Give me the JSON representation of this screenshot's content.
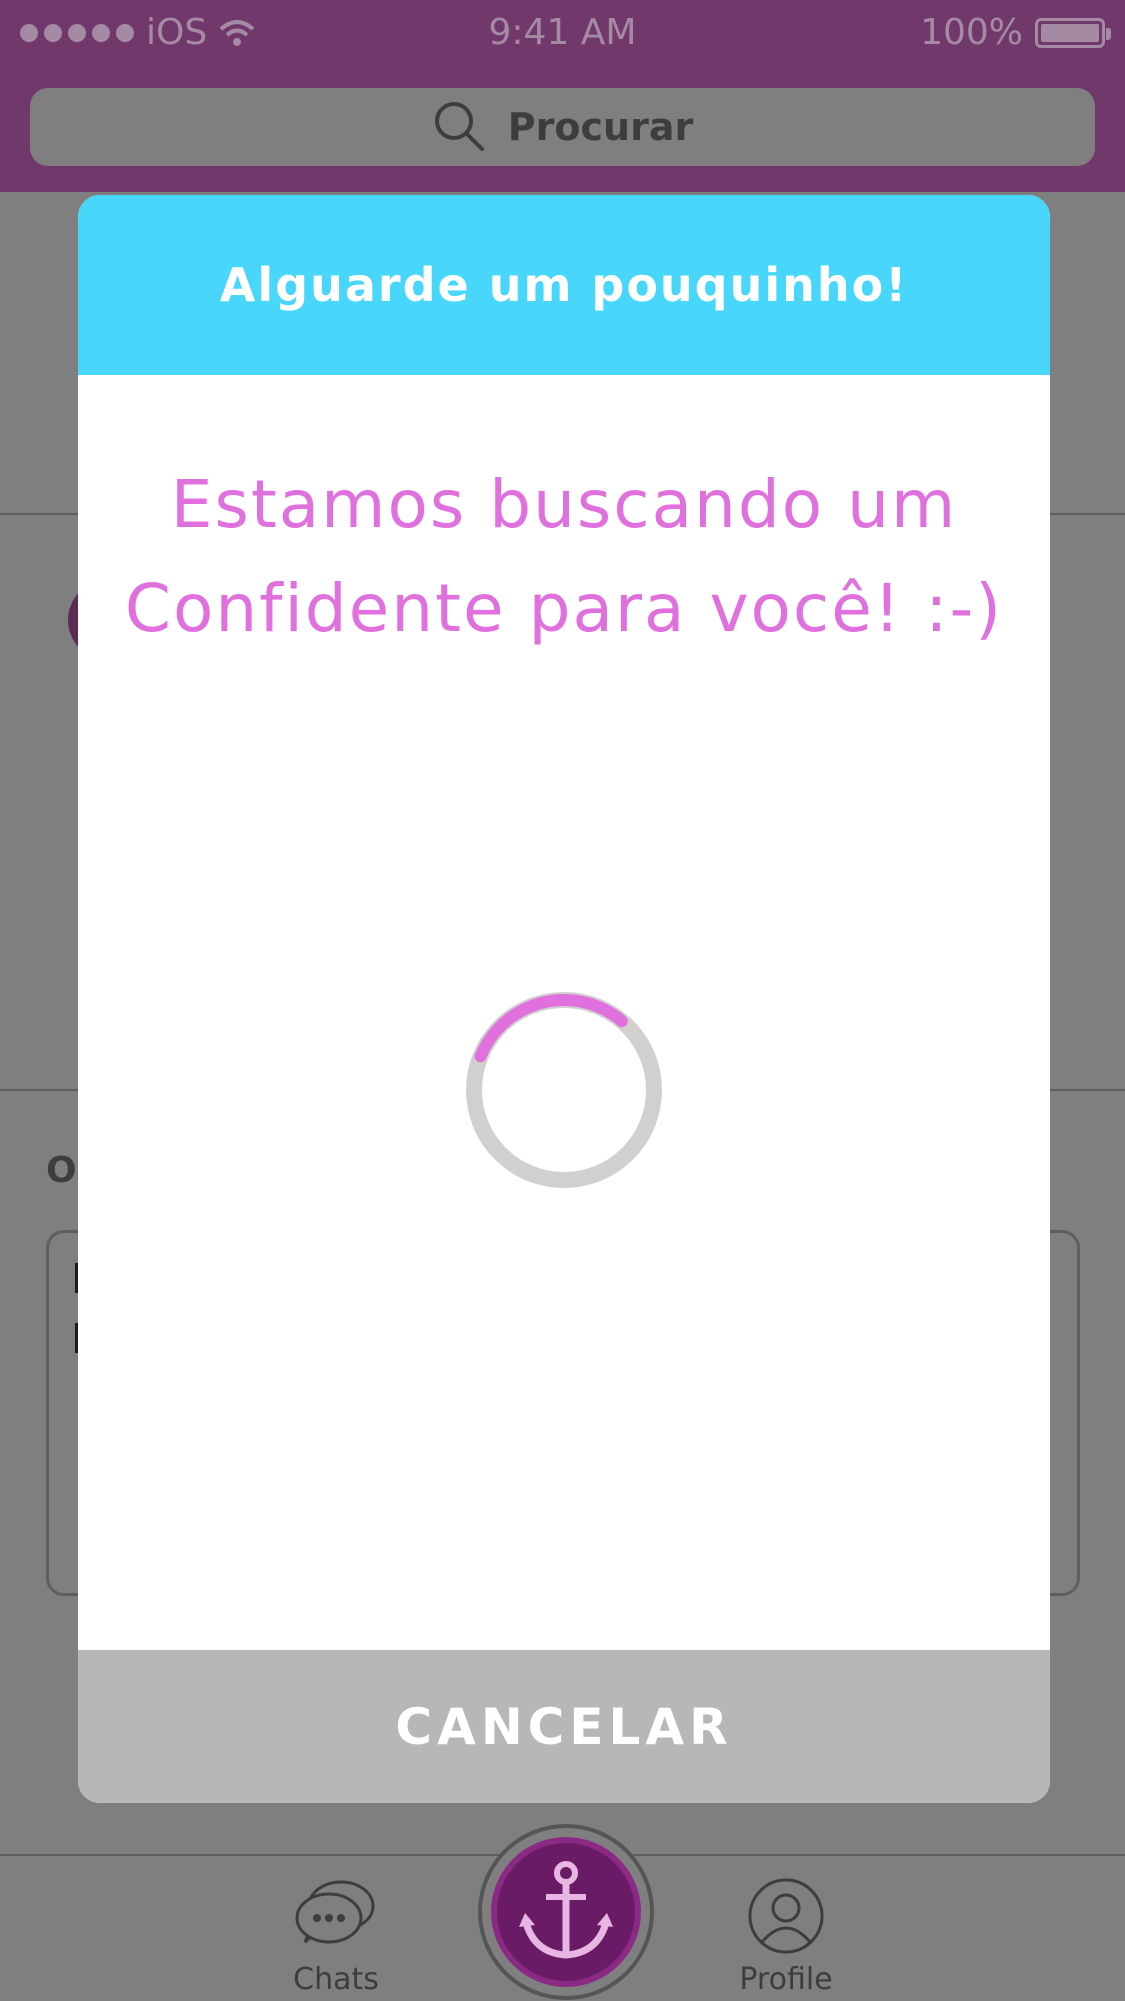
{
  "status_bar": {
    "carrier": "iOS",
    "time": "9:41 AM",
    "battery": "100%"
  },
  "search": {
    "placeholder": "Procurar"
  },
  "background": {
    "section_label": "O"
  },
  "modal": {
    "title": "Alguarde um pouquinho!",
    "message_line1": "Estamos buscando um",
    "message_line2": "Confidente para você! :-)",
    "cancel_label": "CANCELAR",
    "spinner_progress": 0.3
  },
  "tabs": [
    {
      "label": "Chats",
      "icon": "chat-bubbles-icon"
    },
    {
      "label": "anchor",
      "icon": "anchor-icon"
    },
    {
      "label": "Profile",
      "icon": "user-icon"
    }
  ],
  "colors": {
    "accent_pink": "#e070dd",
    "header_cyan": "#48d6fa",
    "brand_purple": "#70386b",
    "cancel_gray": "#b7b7b7",
    "spinner_track": "#d2cfcf"
  }
}
